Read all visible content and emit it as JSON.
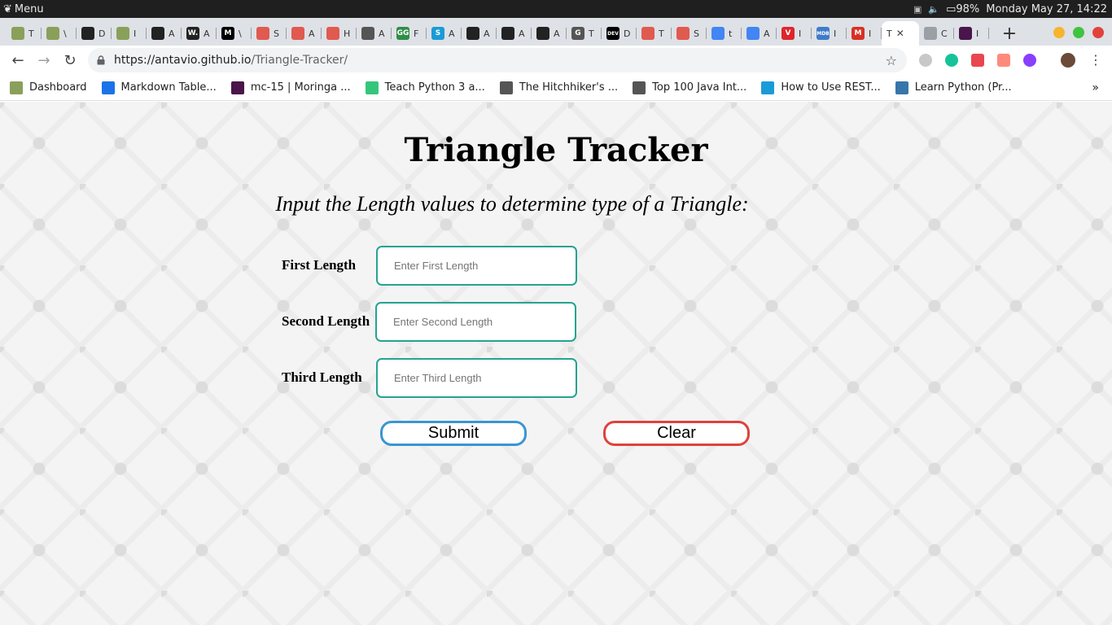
{
  "os_panel": {
    "menu_label": "Menu",
    "battery": "98%",
    "datetime": "Monday May 27, 14:22"
  },
  "tabs": [
    {
      "icon": "tree-icon",
      "title": "T",
      "color": "#8aa05a"
    },
    {
      "icon": "tree-icon",
      "title": "\\",
      "color": "#8aa05a"
    },
    {
      "icon": "github-icon",
      "title": "D",
      "color": "#222222"
    },
    {
      "icon": "tree-icon",
      "title": "I",
      "color": "#8aa05a"
    },
    {
      "icon": "github-icon",
      "title": "A",
      "color": "#222222"
    },
    {
      "icon": "w-icon",
      "title": "A",
      "color": "#222222",
      "glyph": "W."
    },
    {
      "icon": "medium-icon",
      "title": "\\",
      "color": "#000000",
      "glyph": "M"
    },
    {
      "icon": "spiral-icon",
      "title": "S",
      "color": "#e05a4f"
    },
    {
      "icon": "spiral-icon",
      "title": "A",
      "color": "#e05a4f"
    },
    {
      "icon": "spiral-icon",
      "title": "H",
      "color": "#e05a4f"
    },
    {
      "icon": "g-swirl-icon",
      "title": "A",
      "color": "#555555"
    },
    {
      "icon": "geeks-icon",
      "title": "F",
      "color": "#2f8d46",
      "glyph": "GG"
    },
    {
      "icon": "s-icon",
      "title": "A",
      "color": "#1a9bd7",
      "glyph": "S"
    },
    {
      "icon": "github-icon",
      "title": "A",
      "color": "#222222"
    },
    {
      "icon": "github-icon",
      "title": "A",
      "color": "#222222"
    },
    {
      "icon": "github-icon",
      "title": "A",
      "color": "#222222"
    },
    {
      "icon": "g-icon",
      "title": "T",
      "color": "#555555",
      "glyph": "G"
    },
    {
      "icon": "dev-icon",
      "title": "D",
      "color": "#000000",
      "glyph": "DEV"
    },
    {
      "icon": "spiral-icon",
      "title": "T",
      "color": "#e05a4f"
    },
    {
      "icon": "spiral-icon",
      "title": "S",
      "color": "#e05a4f"
    },
    {
      "icon": "docs-icon",
      "title": "t",
      "color": "#4285f4"
    },
    {
      "icon": "docs-icon",
      "title": "A",
      "color": "#4285f4"
    },
    {
      "icon": "vivaldi-icon",
      "title": "I",
      "color": "#e0242b",
      "glyph": "V"
    },
    {
      "icon": "mdb-icon",
      "title": "I",
      "color": "#3f7cc8",
      "glyph": "MDB"
    },
    {
      "icon": "gmail-icon",
      "title": "I",
      "color": "#d93025",
      "glyph": "M"
    }
  ],
  "active_tab": {
    "title": "T",
    "close": "✕"
  },
  "tabs_after": [
    {
      "icon": "page-icon",
      "title": "C",
      "color": "#9aa0a6"
    },
    {
      "icon": "slack-icon",
      "title": "I",
      "color": "#4a154b"
    }
  ],
  "toolbar": {
    "url_host": "https://antavio.github.io",
    "url_path": "/Triangle-Tracker/"
  },
  "bookmarks": [
    {
      "label": "Dashboard",
      "color": "#8aa05a"
    },
    {
      "label": "Markdown Table...",
      "color": "#1a73e8"
    },
    {
      "label": "mc-15 | Moringa ...",
      "color": "#4a154b"
    },
    {
      "label": "Teach Python 3 a...",
      "color": "#34c77b"
    },
    {
      "label": "The Hitchhiker's ...",
      "color": "#555555"
    },
    {
      "label": "Top 100 Java Int...",
      "color": "#555555"
    },
    {
      "label": "How to Use REST...",
      "color": "#1a9bd7"
    },
    {
      "label": "Learn Python (Pr...",
      "color": "#3776ab"
    }
  ],
  "bookmarks_more": "»",
  "main": {
    "title": "Triangle Tracker",
    "subtitle": "Input the Length values to determine type of a Triangle:",
    "fields": [
      {
        "label": "First Length",
        "placeholder": "Enter First Length",
        "value": ""
      },
      {
        "label": "Second Length",
        "placeholder": "Enter Second Length",
        "value": ""
      },
      {
        "label": "Third Length",
        "placeholder": "Enter Third Length",
        "value": ""
      }
    ],
    "submit_label": "Submit",
    "clear_label": "Clear"
  },
  "colors": {
    "input_border": "#26a390",
    "submit_border": "#3a95d3",
    "clear_border": "#e0413b"
  }
}
